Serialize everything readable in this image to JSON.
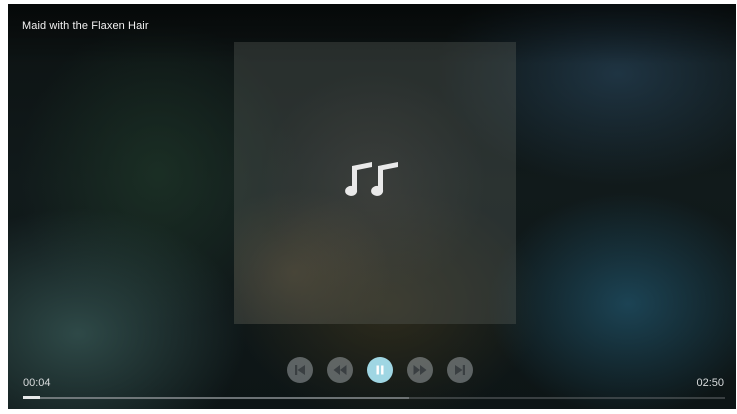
{
  "player": {
    "title": "Maid with the Flaxen Hair",
    "album_art_icon": "music-notes-icon",
    "controls": [
      {
        "name": "skip-previous",
        "icon": "skip-previous-icon"
      },
      {
        "name": "rewind",
        "icon": "rewind-icon"
      },
      {
        "name": "pause",
        "icon": "pause-icon",
        "active": true
      },
      {
        "name": "fast-forward",
        "icon": "fast-forward-icon"
      },
      {
        "name": "skip-next",
        "icon": "skip-next-icon"
      }
    ],
    "elapsed": "00:04",
    "duration": "02:50",
    "progress_fraction": 0.024,
    "buffered_fraction": 0.55
  },
  "colors": {
    "accent": "#9fd6e3",
    "button_bg": "#a5acaf",
    "text": "#f2f2f2"
  }
}
